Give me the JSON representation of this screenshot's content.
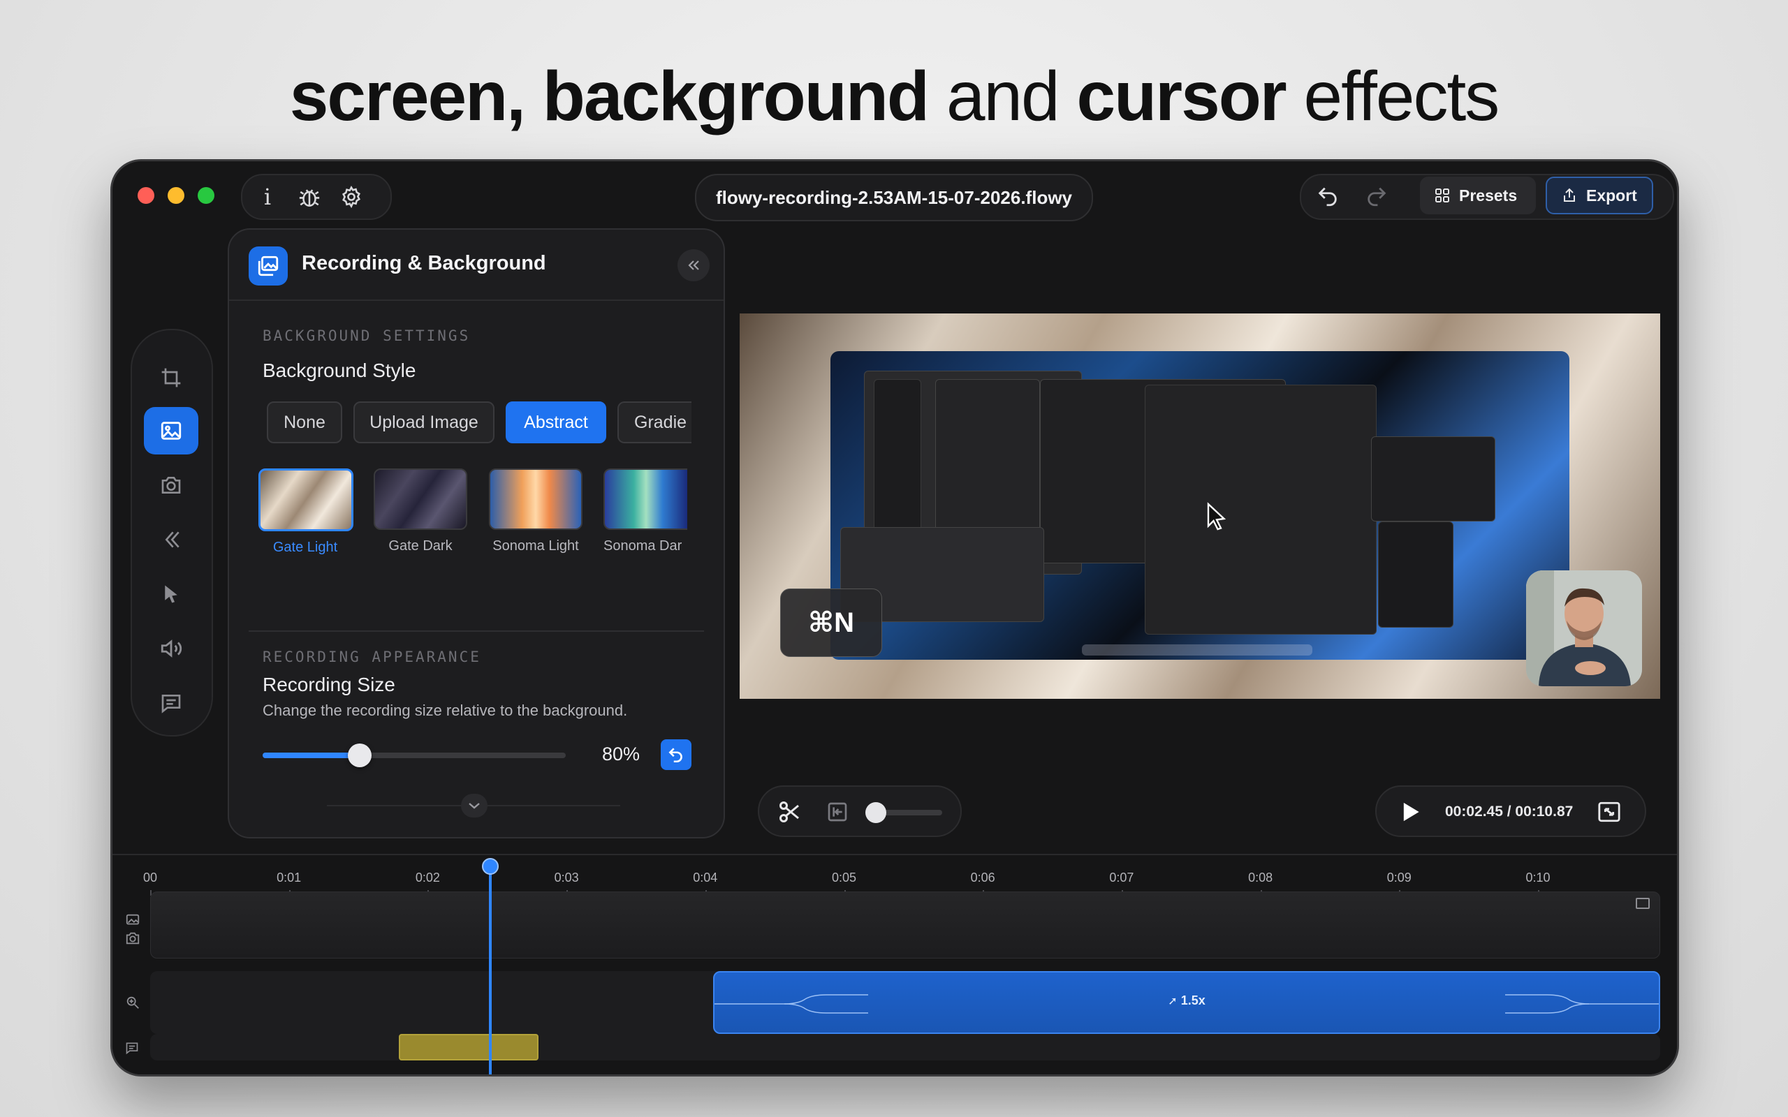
{
  "headline": {
    "bold1": "screen, background",
    "light1": "and",
    "bold2": "cursor",
    "light2": "effects"
  },
  "window": {
    "file_name": "flowy-recording-2.53AM-15-07-2026.flowy",
    "toolbar": {
      "presets_label": "Presets",
      "export_label": "Export"
    },
    "icons": {
      "info": "i",
      "debug": "bug-icon",
      "settings": "gear-icon",
      "undo": "undo-icon",
      "redo": "redo-icon"
    }
  },
  "rail": {
    "items": [
      "crop-icon",
      "image-icon",
      "camera-icon",
      "motion-icon",
      "cursor-icon",
      "sound-icon",
      "caption-icon"
    ],
    "active_index": 1
  },
  "panel": {
    "title": "Recording & Background",
    "background_section": "BACKGROUND SETTINGS",
    "background_style_title": "Background Style",
    "style_options": [
      "None",
      "Upload Image",
      "Abstract",
      "Gradie"
    ],
    "selected_style": "Abstract",
    "wallpapers": [
      "Gate Light",
      "Gate Dark",
      "Sonoma Light",
      "Sonoma Dar"
    ],
    "selected_wallpaper": "Gate Light",
    "appearance_section": "RECORDING APPEARANCE",
    "size_title": "Recording Size",
    "size_desc": "Change the recording size relative to the background.",
    "size_value_label": "80%",
    "size_value": 0.8
  },
  "preview": {
    "shortcut": "⌘N"
  },
  "playback": {
    "current_time": "00:02.45",
    "separator": "/",
    "total_time": "00:10.87",
    "time_text": "00:02.45 / 00:10.87"
  },
  "timeline": {
    "ticks": [
      "00",
      "0:01",
      "0:02",
      "0:03",
      "0:04",
      "0:05",
      "0:06",
      "0:07",
      "0:08",
      "0:09",
      "0:10"
    ],
    "zoom_label": "1.5x",
    "playhead_time": 2.45
  },
  "colors": {
    "accent": "#1f73f0",
    "traffic_red": "#ff5f57",
    "traffic_yellow": "#febc2e",
    "traffic_green": "#28c840",
    "caption_clip": "#9a8a2e"
  }
}
